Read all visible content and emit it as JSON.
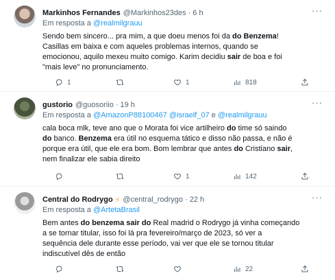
{
  "tweets": [
    {
      "author": "Markinhos Fernandes",
      "handle": "@Markinhos23des",
      "sep": "·",
      "time": "6 h",
      "reply_prefix": "Em resposta a",
      "mentions": [
        "@realmilgrauu"
      ],
      "mention_joiner": " e ",
      "body": [
        [
          {
            "t": "Sendo bem sincero... pra mim, a que doeu menos foi da "
          },
          {
            "t": "do Benzema",
            "b": true
          },
          {
            "t": "!"
          }
        ],
        [
          {
            "t": "Casillas em baixa e com aqueles problemas internos, quando se"
          }
        ],
        [
          {
            "t": "emocionou, aquilo mexeu muito comigo. Karim decidiu "
          },
          {
            "t": "sair",
            "b": true
          },
          {
            "t": " de boa e foi"
          }
        ],
        [
          {
            "t": "\"mais leve\" no pronunciamento."
          }
        ]
      ],
      "stats": {
        "replies": "1",
        "retweets": "",
        "likes": "1",
        "views": "818"
      }
    },
    {
      "author": "gustorio",
      "handle": "@guosoriio",
      "sep": "·",
      "time": "19 h",
      "reply_prefix": "Em resposta a",
      "mentions": [
        "@AmazonP88100467",
        "@israelf_07",
        "@realmilgrauu"
      ],
      "mention_joiner": " e ",
      "body": [
        [
          {
            "t": "cala boca mlk, teve ano que o Morata foi vice artilheiro "
          },
          {
            "t": "do",
            "b": true
          },
          {
            "t": " time só saindo"
          }
        ],
        [
          {
            "t": "do",
            "b": true
          },
          {
            "t": " banco. "
          },
          {
            "t": "Benzema",
            "b": true
          },
          {
            "t": " era útil no esquema tático e disso não passa, e não é"
          }
        ],
        [
          {
            "t": "porque era útil, que ele era bom. Bom lembrar que antes "
          },
          {
            "t": "do",
            "b": true
          },
          {
            "t": " Cristiano "
          },
          {
            "t": "sair",
            "b": true
          },
          {
            "t": ","
          }
        ],
        [
          {
            "t": "nem finalizar ele sabia direito"
          }
        ]
      ],
      "stats": {
        "replies": "",
        "retweets": "",
        "likes": "1",
        "views": "142"
      }
    },
    {
      "author": "Central do Rodrygo",
      "bolt": "⚡",
      "handle": "@central_rodrygo",
      "sep": "·",
      "time": "22 h",
      "reply_prefix": "Em resposta a",
      "mentions": [
        "@ArtetaBrasil"
      ],
      "mention_joiner": " e ",
      "body": [
        [
          {
            "t": "Bem antes "
          },
          {
            "t": "do benzema sair do",
            "b": true
          },
          {
            "t": " Real madrid o Rodrygo já vinha começando"
          }
        ],
        [
          {
            "t": "a se tornar titular, isso foi lá pra fevereiro/março de 2023, só ver a"
          }
        ],
        [
          {
            "t": "sequência dele durante esse período, vai ver que ele se tornou titular"
          }
        ],
        [
          {
            "t": "indiscutível dês de então"
          }
        ]
      ],
      "stats": {
        "replies": "",
        "retweets": "",
        "likes": "",
        "views": "22"
      }
    }
  ],
  "colors": {
    "text": "#0f1419",
    "muted": "#536471",
    "link": "#1d9bf0",
    "divider": "#eff3f4",
    "bolt": "#f5a623"
  },
  "icons": [
    "reply-icon",
    "retweet-icon",
    "like-icon",
    "views-icon",
    "share-icon",
    "more-icon"
  ]
}
